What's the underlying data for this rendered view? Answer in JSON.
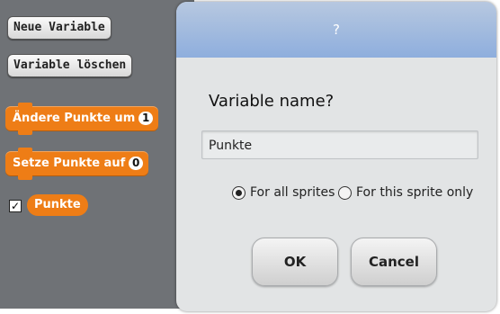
{
  "palette": {
    "new_variable_label": "Neue Variable",
    "delete_variable_label": "Variable löschen",
    "change_block": {
      "text": "Ändere Punkte um",
      "value": "1"
    },
    "set_block": {
      "text": "Setze Punkte auf",
      "value": "0"
    },
    "variable_checkbox": "✓",
    "variable_name": "Punkte"
  },
  "dialog": {
    "title": "?",
    "prompt": "Variable name?",
    "input_value": "Punkte",
    "radio_all": "For all sprites",
    "radio_this": "For this sprite only",
    "ok_label": "OK",
    "cancel_label": "Cancel"
  },
  "colors": {
    "variables_orange": "#ee7d16",
    "palette_bg": "#6f7276",
    "dialog_title": "#8eaedd"
  }
}
